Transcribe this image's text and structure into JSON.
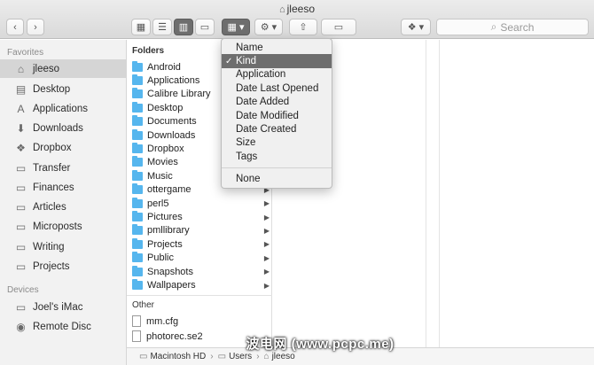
{
  "window": {
    "title": "jleeso"
  },
  "toolbar": {
    "back_icon": "chevron-left-icon",
    "forward_icon": "chevron-right-icon",
    "view_icons": [
      "icon-view-icon",
      "list-view-icon",
      "column-view-icon",
      "cover-flow-icon"
    ],
    "arrange_icon": "grid-arrange-icon",
    "action_icon": "gear-icon",
    "share_icon": "share-icon",
    "tags_icon": "tag-icon",
    "dropbox_icon": "dropbox-icon",
    "search_placeholder": "Search"
  },
  "sidebar": {
    "favorites_label": "Favorites",
    "devices_label": "Devices",
    "favorites": [
      {
        "label": "jleeso",
        "icon": "home-icon",
        "selected": true
      },
      {
        "label": "Desktop",
        "icon": "desktop-icon"
      },
      {
        "label": "Applications",
        "icon": "applications-icon"
      },
      {
        "label": "Downloads",
        "icon": "downloads-icon"
      },
      {
        "label": "Dropbox",
        "icon": "dropbox-icon"
      },
      {
        "label": "Transfer",
        "icon": "folder-icon"
      },
      {
        "label": "Finances",
        "icon": "folder-icon"
      },
      {
        "label": "Articles",
        "icon": "folder-icon"
      },
      {
        "label": "Microposts",
        "icon": "folder-icon"
      },
      {
        "label": "Writing",
        "icon": "folder-icon"
      },
      {
        "label": "Projects",
        "icon": "folder-icon"
      }
    ],
    "devices": [
      {
        "label": "Joel's iMac",
        "icon": "imac-icon"
      },
      {
        "label": "Remote Disc",
        "icon": "disc-icon"
      }
    ]
  },
  "folders_column": {
    "folders_label": "Folders",
    "folders": [
      "Android",
      "Applications",
      "Calibre Library",
      "Desktop",
      "Documents",
      "Downloads",
      "Dropbox",
      "Movies",
      "Music",
      "ottergame",
      "perl5",
      "Pictures",
      "pmllibrary",
      "Projects",
      "Public",
      "Snapshots",
      "Wallpapers"
    ],
    "other_label": "Other",
    "files": [
      "mm.cfg",
      "photorec.se2"
    ]
  },
  "arrange_menu": {
    "items": [
      "Name",
      "Kind",
      "Application",
      "Date Last Opened",
      "Date Added",
      "Date Modified",
      "Date Created",
      "Size",
      "Tags",
      "None"
    ],
    "selected": "Kind",
    "check_glyph": "✓"
  },
  "path_bar": {
    "segments": [
      "Macintosh HD",
      "Users",
      "jleeso"
    ]
  },
  "watermark": {
    "text": "波电网 (www.pcpc.me)"
  }
}
